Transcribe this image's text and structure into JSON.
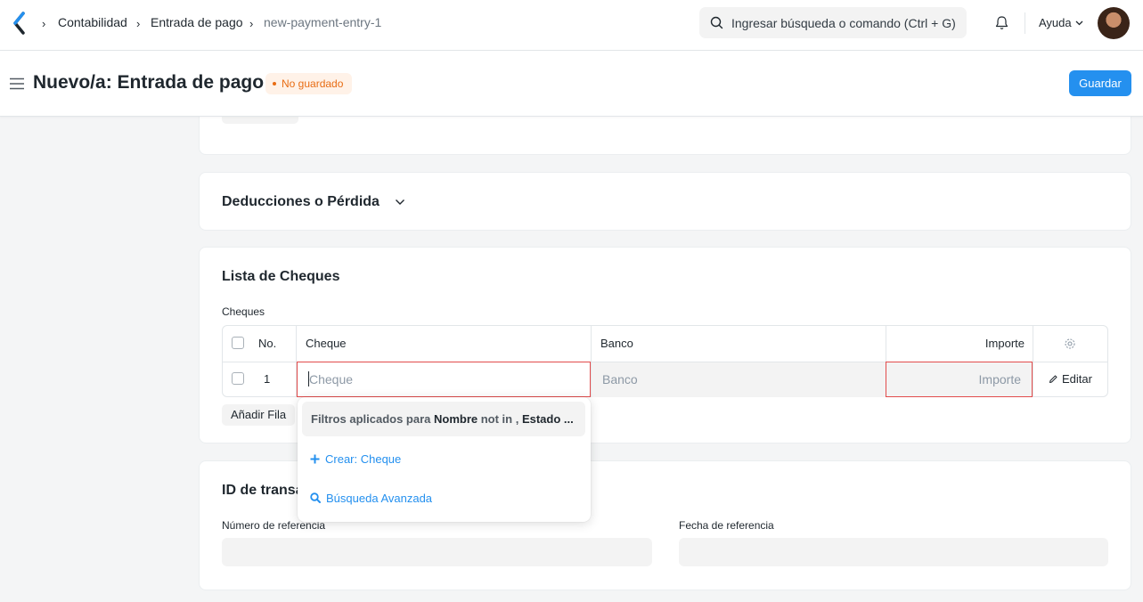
{
  "breadcrumbs": [
    "Contabilidad",
    "Entrada de pago",
    "new-payment-entry-1"
  ],
  "search": {
    "placeholder": "Ingresar búsqueda o comando (Ctrl + G)"
  },
  "help_label": "Ayuda",
  "page": {
    "title": "Nuevo/a: Entrada de pago",
    "status": "No guardado",
    "save_label": "Guardar"
  },
  "sections": {
    "deductions_title": "Deducciones o Pérdida",
    "cheques_title": "Lista de Cheques",
    "transaction_title": "ID de transacción"
  },
  "cheques_table": {
    "label": "Cheques",
    "columns": [
      "No.",
      "Cheque",
      "Banco",
      "Importe"
    ],
    "rows": [
      {
        "no": "1",
        "cheque_placeholder": "Cheque",
        "banco_placeholder": "Banco",
        "importe_placeholder": "Importe",
        "edit_label": "Editar"
      }
    ],
    "add_row_label": "Añadir Fila"
  },
  "dropdown": {
    "filter_prefix": "Filtros aplicados para ",
    "filter_field1": "Nombre",
    "filter_mid": " not in , ",
    "filter_field2": "Estado ...",
    "create_label": "Crear: Cheque",
    "advanced_label": "Búsqueda Avanzada"
  },
  "reference": {
    "number_label": "Número de referencia",
    "date_label": "Fecha de referencia"
  },
  "colors": {
    "primary": "#2490ef",
    "warning": "#e86c13",
    "error_border": "#e24c4c"
  }
}
